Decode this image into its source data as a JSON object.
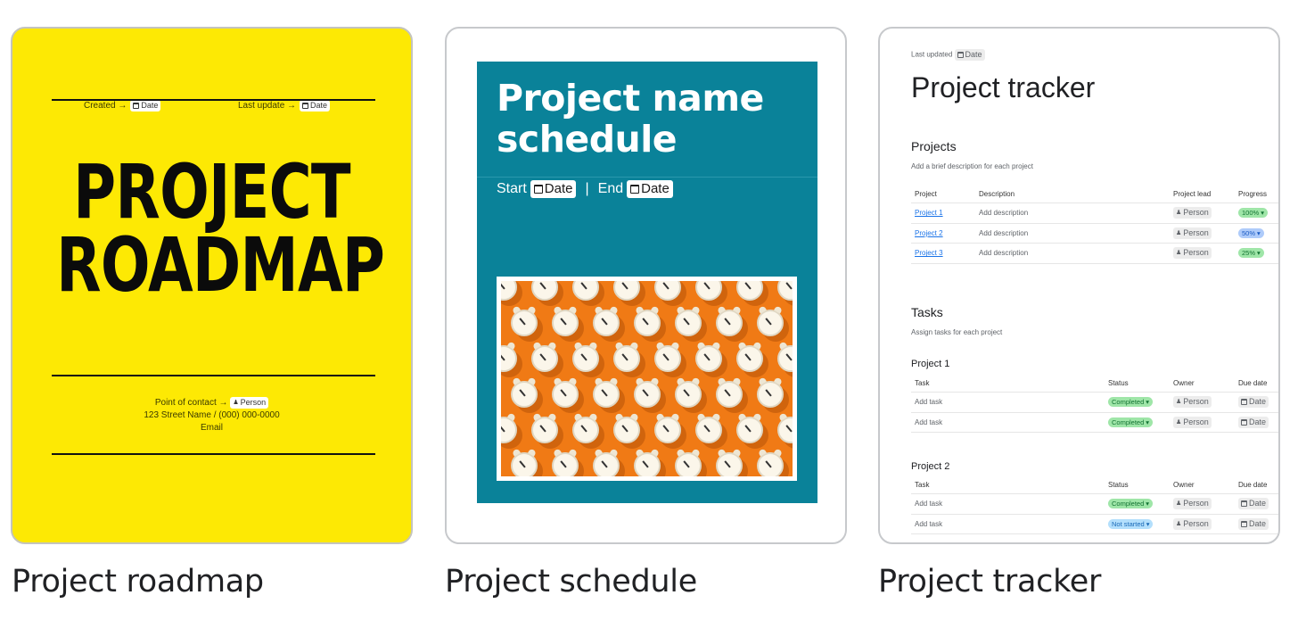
{
  "templates": [
    {
      "caption": "Project roadmap",
      "created_label": "Created →",
      "date_chip": "Date",
      "last_update_label": "Last update →",
      "title_line1": "PROJECT",
      "title_line2": "ROADMAP",
      "contact_label": "Point of contact →",
      "person_chip": "Person",
      "address": "123 Street Name / (000) 000-0000",
      "email": "Email"
    },
    {
      "caption": "Project schedule",
      "title_line1": "Project name",
      "title_line2": "schedule",
      "start_label": "Start",
      "end_label": "End",
      "date_chip": "Date",
      "separator": "|",
      "image_alt": "alarm clocks on orange background"
    },
    {
      "caption": "Project tracker",
      "last_updated_label": "Last updated",
      "date_chip": "Date",
      "title": "Project tracker",
      "projects_heading": "Projects",
      "projects_desc": "Add a brief description for each project",
      "projects_columns": [
        "Project",
        "Description",
        "Project lead",
        "Progress"
      ],
      "projects_rows": [
        {
          "project": "Project 1",
          "description": "Add description",
          "lead": "Person",
          "progress": "100%"
        },
        {
          "project": "Project 2",
          "description": "Add description",
          "lead": "Person",
          "progress": "50%"
        },
        {
          "project": "Project 3",
          "description": "Add description",
          "lead": "Person",
          "progress": "25%"
        }
      ],
      "tasks_heading": "Tasks",
      "tasks_desc": "Assign tasks for each project",
      "task_columns": [
        "Task",
        "Status",
        "Owner",
        "Due date"
      ],
      "task_groups": [
        {
          "name": "Project 1",
          "rows": [
            {
              "task": "Add task",
              "status": "Completed",
              "owner": "Person",
              "due": "Date"
            },
            {
              "task": "Add task",
              "status": "Completed",
              "owner": "Person",
              "due": "Date"
            }
          ]
        },
        {
          "name": "Project 2",
          "rows": [
            {
              "task": "Add task",
              "status": "Completed",
              "owner": "Person",
              "due": "Date"
            },
            {
              "task": "Add task",
              "status": "Not started",
              "owner": "Person",
              "due": "Date"
            }
          ]
        }
      ]
    }
  ],
  "colors": {
    "roadmap_bg": "#fde904",
    "schedule_block": "#0a8299",
    "photo_bg": "#f07a15",
    "pill_green": "#9fe6a8",
    "pill_blue": "#aecbfa"
  }
}
